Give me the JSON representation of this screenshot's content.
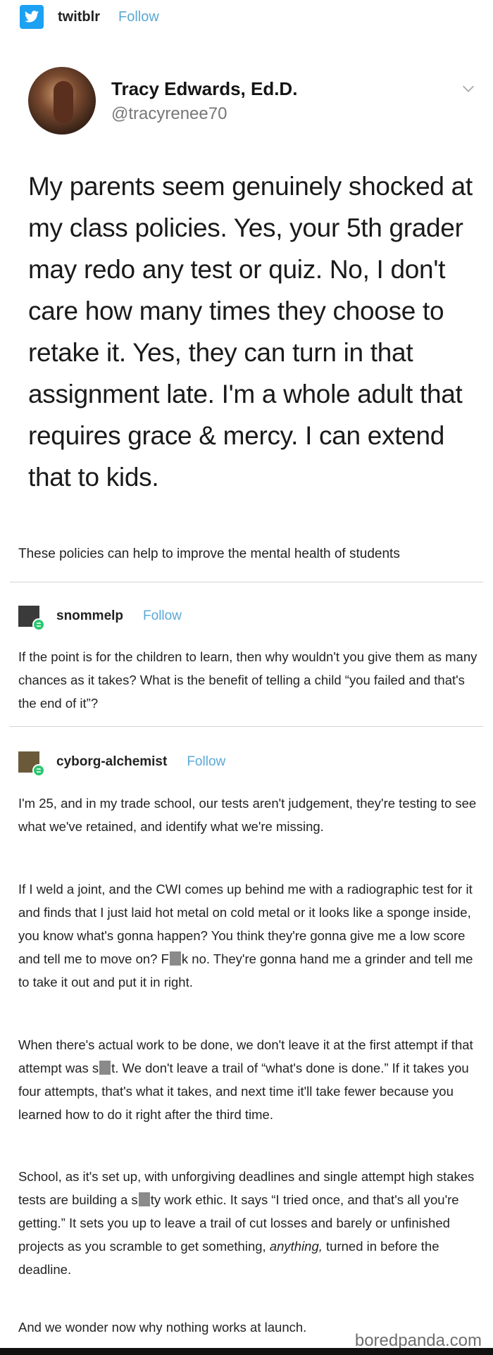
{
  "header": {
    "source_name": "twitblr",
    "follow_label": "Follow",
    "brand_color": "#1da1f2"
  },
  "tweet": {
    "author_name": "Tracy Edwards, Ed.D.",
    "author_handle": "@tracyrenee70",
    "body": "My parents seem genuinely shocked at my class policies. Yes, your 5th grader may redo any test or quiz. No, I don't care how many times they choose to retake it. Yes, they can turn in that assignment late. I'm a whole adult that requires grace & mercy. I can extend that to kids."
  },
  "caption": "These policies can help to improve the mental health of students",
  "reblog1": {
    "username": "snommelp",
    "follow_label": "Follow",
    "text": "If the point is for the children to learn, then why wouldn't you give them as many chances as it takes? What is the benefit of telling a child “you failed and that's the end of it”?"
  },
  "reblog2": {
    "username": "cyborg-alchemist",
    "follow_label": "Follow",
    "p1": "I'm 25, and in my trade school, our tests aren't judgement, they're testing to see what we've retained, and identify what we're missing.",
    "p2_a": "If I weld a joint, and the CWI comes up behind me with a radiographic test for it and finds that I just laid hot metal on cold metal or it looks like a sponge inside, you know what's gonna happen? You think they're gonna give me a low score and tell me to move on? F",
    "p2_b": "k no. They're gonna hand me a grinder and tell me to take it out and put it in right.",
    "p3_a": "When there's actual work to be done, we don't leave it at the first attempt if that attempt was s",
    "p3_b": "t. We don't leave a trail of “what's done is done.” If it takes you four attempts, that's what it takes, and next time it'll take fewer because you learned how to do it right after the third time.",
    "p4_a": "School, as it's set up, with unforgiving deadlines and single attempt high stakes tests are building a s",
    "p4_b": "ty work ethic. It says “I tried once, and that's all you're getting.” It sets you up to leave a trail of cut losses and barely or unfinished projects as you scramble to get something, ",
    "p4_em": "anything,",
    "p4_c": " turned in before the deadline.",
    "p5": "And we wonder now why nothing works at launch."
  },
  "watermark": "boredpanda.com"
}
